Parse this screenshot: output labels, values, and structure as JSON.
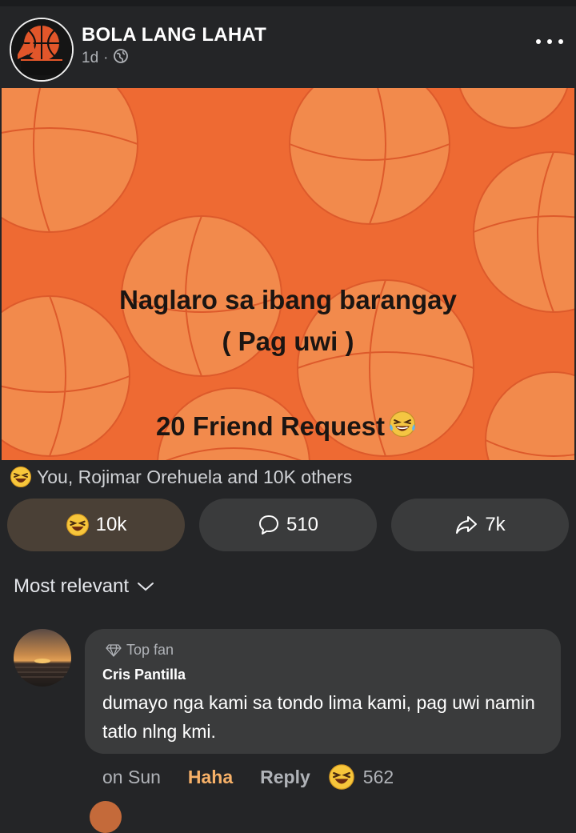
{
  "post": {
    "page_name": "BOLA LANG LAHAT",
    "time": "1d",
    "separator": "·",
    "avatar_logo_text": "BOLA LANG LAHAT",
    "image": {
      "line1": "Naglaro sa ibang barangay",
      "line2": "( Pag uwi )",
      "line3": "20 Friend Request",
      "background_color": "#ee6a33"
    },
    "reactions_summary": "You, Rojimar Orehuela and 10K others",
    "actions": {
      "react_count": "10k",
      "comment_count": "510",
      "share_count": "7k"
    }
  },
  "sort": {
    "label": "Most relevant"
  },
  "comment": {
    "badge": "Top fan",
    "author": "Cris Pantilla",
    "text": "dumayo nga kami sa tondo lima kami, pag uwi namin tatlo nlng kmi.",
    "time": "on Sun",
    "reaction_label": "Haha",
    "reply_label": "Reply",
    "reaction_count": "562"
  },
  "colors": {
    "background": "#242527",
    "button": "#3a3b3c",
    "haha": "#f7b168",
    "accent_orange": "#ee6a33"
  },
  "icons": [
    "more-icon",
    "globe-icon",
    "haha-emoji-icon",
    "comment-icon",
    "share-icon",
    "chevron-down-icon",
    "diamond-icon"
  ]
}
